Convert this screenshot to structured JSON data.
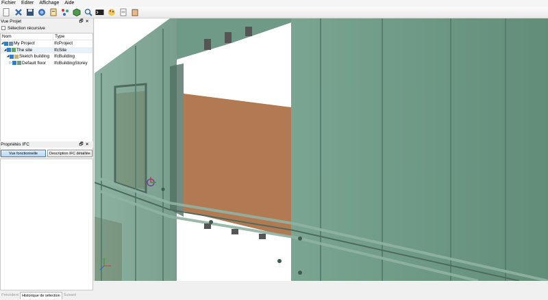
{
  "menu": [
    "Fichier",
    "Editer",
    "Affichage",
    "Aide"
  ],
  "toolbar_icons": [
    "new-file-icon",
    "close-x-icon",
    "save-icon",
    "globe-icon",
    "script-icon",
    "network-icon",
    "cube-icon",
    "zoom-icon",
    "console-icon",
    "palette-icon",
    "document-icon",
    "clipboard-icon"
  ],
  "project_panel": {
    "title": "Vue Projet",
    "recursive_label": "Sélection récursive",
    "columns": {
      "name": "Nom",
      "type": "Type"
    },
    "rows": [
      {
        "name": "My Project",
        "type": "IfcProject"
      },
      {
        "name": "The site",
        "type": "IfcSite"
      },
      {
        "name": "Sketch building",
        "type": "IfcBuilding"
      },
      {
        "name": "Default floor",
        "type": "IfcBuildingStorey"
      }
    ]
  },
  "properties_panel": {
    "title": "Propriétés IFC",
    "btn_functional": "Vue fonctionnelle",
    "btn_detailed": "Description IFC détaillée"
  },
  "history": {
    "prev": "Précédent",
    "tab": "Historique de sélection",
    "next": "Suivant"
  },
  "colors": {
    "glass": "#6f9a87",
    "wood": "#b27a52",
    "selection": "#3c7fb1"
  }
}
